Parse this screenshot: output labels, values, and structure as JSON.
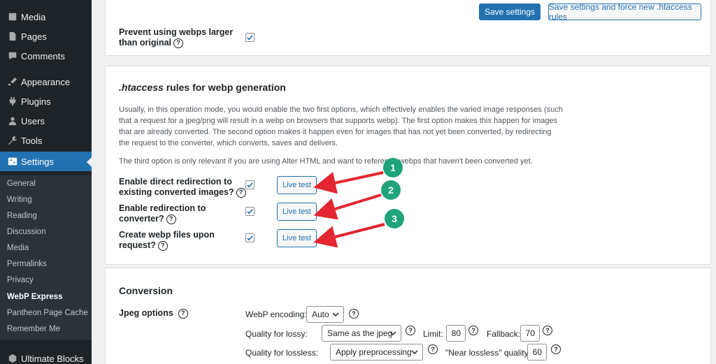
{
  "sidebar": {
    "menu": [
      {
        "label": "Media",
        "icon": "media-icon"
      },
      {
        "label": "Pages",
        "icon": "pages-icon"
      },
      {
        "label": "Comments",
        "icon": "comments-icon"
      },
      {
        "label": "Appearance",
        "icon": "appearance-icon"
      },
      {
        "label": "Plugins",
        "icon": "plugins-icon"
      },
      {
        "label": "Users",
        "icon": "users-icon"
      },
      {
        "label": "Tools",
        "icon": "tools-icon"
      },
      {
        "label": "Settings",
        "icon": "settings-icon"
      }
    ],
    "submenu": [
      "General",
      "Writing",
      "Reading",
      "Discussion",
      "Media",
      "Permalinks",
      "Privacy",
      "WebP Express",
      "Pantheon Page Cache",
      "Remember Me"
    ],
    "bottom_item": "Ultimate Blocks"
  },
  "toolbar": {
    "save_label": "Save settings",
    "save_force_label": "Save settings and force new .htaccess rules"
  },
  "top_card": {
    "prevent_label_1": "Prevent using webps larger",
    "prevent_label_2": "than original"
  },
  "htaccess": {
    "title_em": ".htaccess",
    "title_rest": " rules for webp generation",
    "para1_lines": [
      "Usually, in this operation mode, you would enable the two first options, which effectively enables the varied image responses (such",
      "that a request for a jpeg/png will result in a webp on browsers that supports webp). The first option makes this happen for images",
      "that are already converted. The second option makes it happen even for images that has not yet been converted, by redirecting",
      "the request to the converter, which converts, saves and delivers."
    ],
    "para2": "The third option is only relevant if you are using Alter HTML and want to reference webps that haven't been converted yet.",
    "options": [
      {
        "line1": "Enable direct redirection to",
        "line2": "existing converted images?",
        "checked": true,
        "button": "Live test"
      },
      {
        "line1": "Enable redirection to",
        "line2": "converter?",
        "checked": true,
        "button": "Live test"
      },
      {
        "line1": "Create webp files upon",
        "line2": "request?",
        "checked": true,
        "button": "Live test"
      }
    ]
  },
  "annotations": {
    "markers": [
      "1",
      "2",
      "3"
    ],
    "arrow_color": "#e3262f",
    "marker_color": "#1fa37a"
  },
  "conversion": {
    "title": "Conversion",
    "jpeg_label": "Jpeg options",
    "encoding_label": "WebP encoding:",
    "encoding_value": "Auto",
    "lossy_label": "Quality for lossy:",
    "lossy_value": "Same as the jpeg",
    "limit_label": "Limit:",
    "limit_value": "80",
    "fallback_label": "Fallback:",
    "fallback_value": "70",
    "lossless_label": "Quality for lossless:",
    "lossless_value": "Apply preprocessing",
    "near_lossless_label": "\"Near lossless\" quality:",
    "near_lossless_value": "60"
  },
  "help_glyph": "?"
}
